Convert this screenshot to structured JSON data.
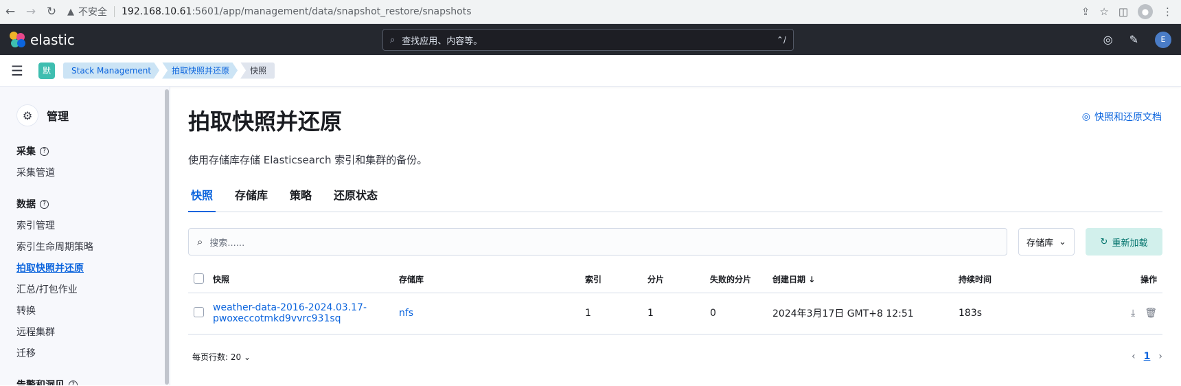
{
  "browser": {
    "insecure_label": "不安全",
    "url_host": "192.168.10.61",
    "url_path": ":5601/app/management/data/snapshot_restore/snapshots"
  },
  "header": {
    "logo_text": "elastic",
    "search_placeholder": "查找应用、内容等。",
    "search_shortcut": "⌃/",
    "avatar": "E"
  },
  "breadcrumb": {
    "space_badge": "默",
    "items": [
      "Stack Management",
      "拍取快照并还原",
      "快照"
    ]
  },
  "sidebar": {
    "title": "管理",
    "groups": [
      {
        "heading": "采集",
        "items": [
          "采集管道"
        ]
      },
      {
        "heading": "数据",
        "items": [
          "索引管理",
          "索引生命周期策略",
          "拍取快照并还原",
          "汇总/打包作业",
          "转换",
          "远程集群",
          "迁移"
        ]
      },
      {
        "heading": "告警和洞见",
        "items": []
      }
    ]
  },
  "main": {
    "title": "拍取快照并还原",
    "doc_link": "快照和还原文档",
    "description": "使用存储库存储 Elasticsearch 索引和集群的备份。",
    "tabs": [
      "快照",
      "存储库",
      "策略",
      "还原状态"
    ],
    "search_placeholder": "搜索......",
    "repo_filter": "存储库",
    "reload_button": "重新加载",
    "columns": [
      "快照",
      "存储库",
      "索引",
      "分片",
      "失败的分片",
      "创建日期",
      "持续时间",
      "操作"
    ],
    "rows": [
      {
        "snapshot_line1": "weather-data-2016-2024.03.17-",
        "snapshot_line2": "pwoxeccotmkd9vvrc931sq",
        "repository": "nfs",
        "indices": "1",
        "shards": "1",
        "failed_shards": "0",
        "date": "2024年3月17日 GMT+8 12:51",
        "duration": "183s"
      }
    ],
    "rows_per_page": "每页行数: 20",
    "current_page": "1"
  },
  "colors": {
    "accent": "#0b64dd",
    "header_bg": "#25282f",
    "success_bg": "#d2f0ec"
  }
}
